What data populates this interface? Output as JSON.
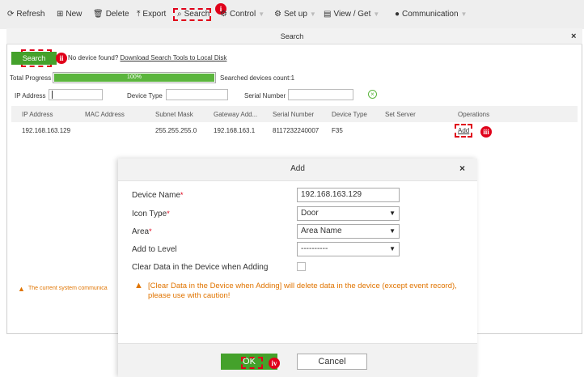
{
  "toolbar": {
    "items": [
      {
        "icon": "refresh-icon",
        "label": "Refresh"
      },
      {
        "icon": "new-icon",
        "label": "New"
      },
      {
        "icon": "trash-icon",
        "label": "Delete"
      },
      {
        "icon": "export-icon",
        "label": "Export"
      },
      {
        "icon": "search-icon",
        "label": "Search"
      },
      {
        "icon": "control-icon",
        "label": "Control"
      },
      {
        "icon": "gear-icon",
        "label": "Set up"
      },
      {
        "icon": "view-icon",
        "label": "View / Get"
      },
      {
        "icon": "communication-icon",
        "label": "Communication"
      }
    ]
  },
  "callouts": {
    "one": "i",
    "two": "ii",
    "three": "iii",
    "four": "iv"
  },
  "search_window": {
    "title": "Search",
    "close": "×",
    "search_button": "Search",
    "no_device_text": "No device found?",
    "download_link": "Download Search Tools to Local Disk",
    "total_progress_label": "Total Progress",
    "progress_percent": "100%",
    "progress_fraction": 1.0,
    "searched_count": "Searched devices count:1",
    "filters": {
      "ip_label": "IP Address",
      "device_type_label": "Device Type",
      "serial_label": "Serial Number"
    },
    "columns": [
      "IP Address",
      "MAC Address",
      "Subnet Mask",
      "Gateway Add...",
      "Serial Number",
      "Device Type",
      "Set Server",
      "Operations"
    ],
    "rows": [
      {
        "ip": "192.168.163.129",
        "mac": "",
        "subnet": "255.255.255.0",
        "gateway": "192.168.163.1",
        "serial": "8117232240007",
        "type": "F35",
        "server": "",
        "operation": "Add"
      }
    ],
    "warning": "The current system communica"
  },
  "add_dialog": {
    "title": "Add",
    "close": "×",
    "device_name_label": "Device Name",
    "device_name_value": "192.168.163.129",
    "icon_type_label": "Icon Type",
    "icon_type_value": "Door",
    "area_label": "Area",
    "area_value": "Area Name",
    "level_label": "Add to Level",
    "level_value": "----------",
    "clear_label": "Clear Data in the Device when Adding",
    "required_mark": "*",
    "warning": "[Clear Data in the Device when Adding] will delete data in the device (except event record), please use with caution!",
    "ok": "OK",
    "cancel": "Cancel"
  },
  "colors": {
    "accent_green": "#44a12b",
    "callout_red": "#e0001a",
    "warning_orange": "#e07400"
  }
}
